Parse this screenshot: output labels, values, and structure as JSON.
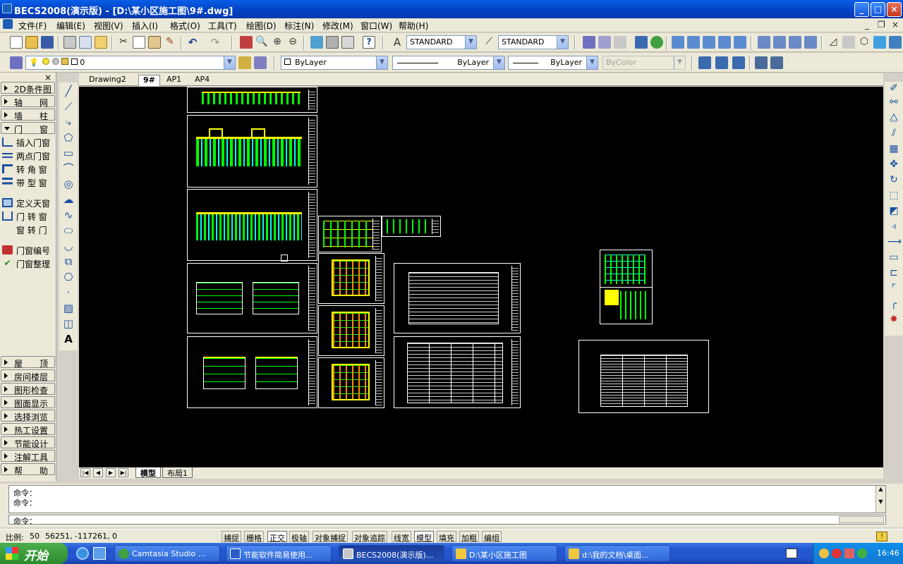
{
  "window": {
    "title": "BECS2008(演示版) - [D:\\某小区施工图\\9#.dwg]",
    "min": "_",
    "max": "□",
    "close": "×"
  },
  "menu": [
    "文件(F)",
    "编辑(E)",
    "视图(V)",
    "插入(I)",
    "格式(O)",
    "工具(T)",
    "绘图(D)",
    "标注(N)",
    "修改(M)",
    "窗口(W)",
    "帮助(H)"
  ],
  "mdi": {
    "min": "_",
    "restore": "❐",
    "close": "×"
  },
  "toolbar": {
    "text_style": "STANDARD",
    "dim_style": "STANDARD",
    "layer": "0",
    "color": "ByLayer",
    "linetype": "ByLayer",
    "lineweight": "ByLayer",
    "plotstyle": "ByColor"
  },
  "left_panel": {
    "close": "×",
    "groups_top": [
      "2D条件图",
      "轴　　网",
      "墙　　柱",
      "门　　窗"
    ],
    "door_items": [
      "插入门窗",
      "两点门窗",
      "转 角 窗",
      "带 型 窗",
      "定义天窗",
      "门 转 窗",
      "窗 转 门",
      "门窗编号",
      "门窗整理"
    ],
    "groups_bottom": [
      "屋　　顶",
      "房间楼层",
      "图形检查",
      "图面显示",
      "选择浏览",
      "热工设置",
      "节能设计",
      "注解工具",
      "帮　　助"
    ]
  },
  "doc_tabs": [
    "Drawing2",
    "9#",
    "AP1",
    "AP4"
  ],
  "doc_tab_active": "9#",
  "layout_tabs": [
    "模型",
    "布局1"
  ],
  "layout_tab_active": "模型",
  "command": {
    "lines": [
      "命令：",
      "命令："
    ],
    "prompt": "命令："
  },
  "status": {
    "scale_label": "比例:",
    "scale": "50",
    "coords": "56251, -117261, 0",
    "toggles": [
      "捕捉",
      "栅格",
      "正交",
      "极轴",
      "对象捕捉",
      "对象追踪",
      "线宽",
      "模型",
      "填充",
      "加粗",
      "编组"
    ],
    "toggles_on": [
      "正交",
      "模型"
    ]
  },
  "taskbar": {
    "start": "开始",
    "tasks": [
      "Camtasia Studio ...",
      "节能软件简易使用...",
      "BECS2008(演示版)...",
      "D:\\某小区施工图",
      "d:\\我的文档\\桌面..."
    ],
    "active_task": 2,
    "time": "16:46"
  },
  "colors": {
    "canvas": "#000000",
    "cad_green": "#00ff00",
    "cad_yellow": "#ffff00",
    "cad_cyan": "#00ffff"
  }
}
